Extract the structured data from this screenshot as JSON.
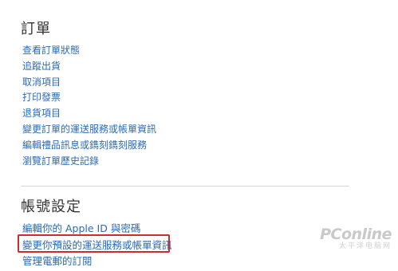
{
  "orders": {
    "title": "訂單",
    "links": [
      "查看訂單狀態",
      "追蹤出貨",
      "取消項目",
      "打印發票",
      "退貨項目",
      "變更訂單的運送服務或帳單資訊",
      "編輯禮品訊息或鐫刻鐫刻服務",
      "瀏覽訂單歷史記錄"
    ]
  },
  "account": {
    "title": "帳號設定",
    "links": [
      "編輯你的 Apple ID 與密碼",
      "變更你預設的運送服務或帳單資訊",
      "管理電郵的訂閱"
    ]
  },
  "highlight": {
    "color": "#d12b2b",
    "target": "變更你預設的運送服務或帳單資訊"
  },
  "watermark": {
    "brand": "PConline",
    "tagline": "太平洋电脑网"
  },
  "colors": {
    "link": "#2a6ab6",
    "heading": "#333333",
    "divider": "#d6d6d6"
  }
}
